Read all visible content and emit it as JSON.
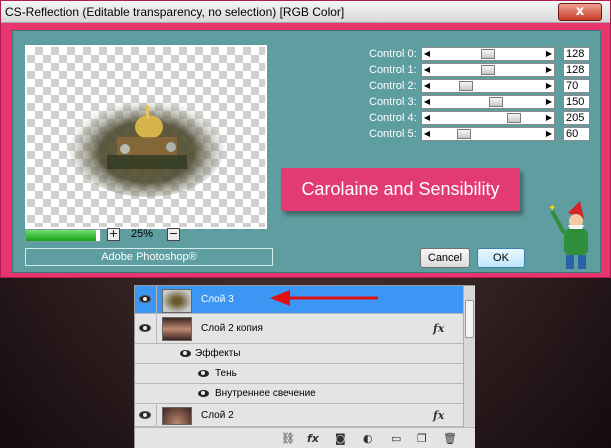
{
  "dialog": {
    "title": "CS-Reflection (Editable transparency, no selection) [RGB Color]",
    "close_label": "x",
    "zoom_level": "25%",
    "zoom_in_label": "+",
    "zoom_out_label": "−",
    "progress": 0.95,
    "brand_text": "Adobe Photoshop®",
    "banner_text": "Carolaine and Sensibility",
    "cancel_label": "Cancel",
    "ok_label": "OK",
    "controls": [
      {
        "label": "Control 0:",
        "value": "128"
      },
      {
        "label": "Control 1:",
        "value": "128"
      },
      {
        "label": "Control 2:",
        "value": "70"
      },
      {
        "label": "Control 3:",
        "value": "150"
      },
      {
        "label": "Control 4:",
        "value": "205"
      },
      {
        "label": "Control 5:",
        "value": "60"
      }
    ]
  },
  "layers": {
    "rows": [
      {
        "name": "Слой 3",
        "selected": true
      },
      {
        "name": "Слой 2 копия",
        "has_fx": true
      },
      {
        "name": "Слой 2",
        "has_fx": true
      }
    ],
    "effects_label": "Эффекты",
    "effects": [
      "Тень",
      "Внутреннее свечение"
    ],
    "fx_label": "fx",
    "footer_icons": [
      "link-icon",
      "fx-icon",
      "mask-icon",
      "adjustment-icon",
      "folder-icon",
      "new-layer-icon",
      "trash-icon"
    ]
  },
  "colors": {
    "dialog_frame": "#e8356e",
    "client_bg": "#5f9ea0",
    "banner_bg": "#e23a73",
    "selected_row": "#3c96f4",
    "arrow": "#e01010"
  }
}
